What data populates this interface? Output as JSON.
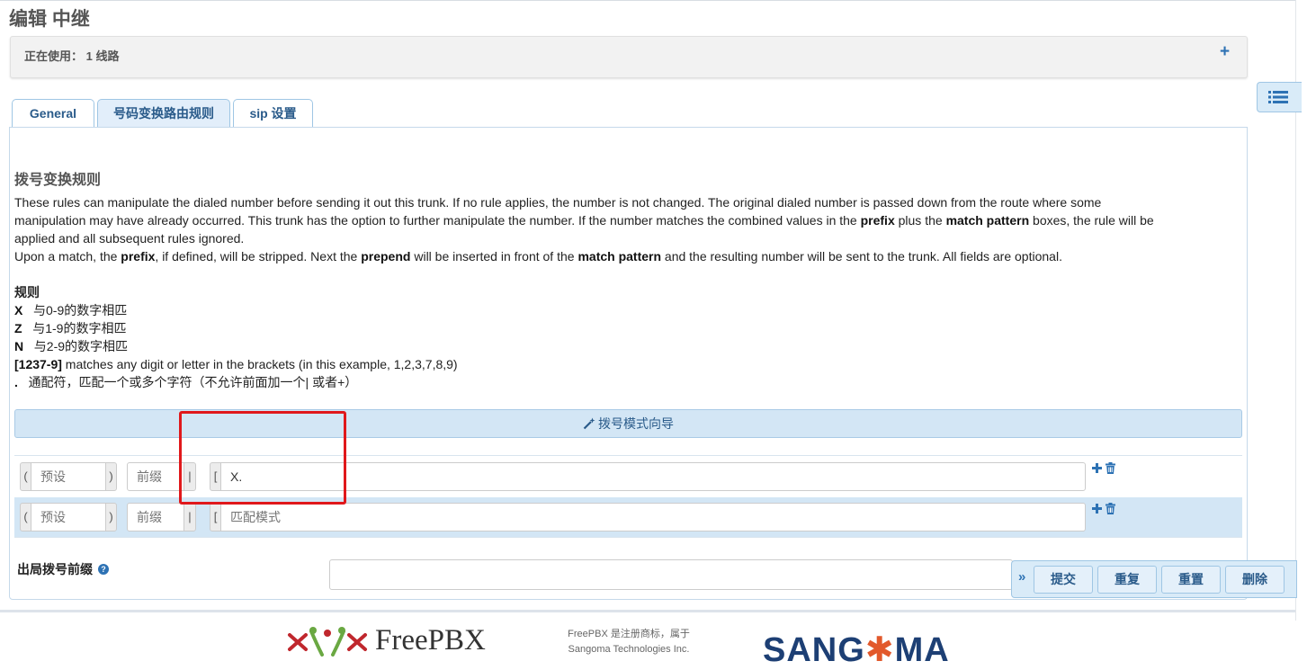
{
  "page": {
    "title": "编辑 中继"
  },
  "in_use": {
    "label": "正在使用： 1 线路",
    "add_symbol": "+"
  },
  "tabs": [
    {
      "label": "General"
    },
    {
      "label": "号码变换路由规则"
    },
    {
      "label": "sip 设置"
    }
  ],
  "dial_rules": {
    "title": "拨号变换规则",
    "desc1": {
      "a": "These rules can manipulate the dialed number before sending it out this trunk. If no rule applies, the number is not changed. The original dialed number is passed down from the route where some",
      "b": "manipulation may have already occurred. This trunk has the option to further manipulate the number. If the number matches the combined values in the ",
      "b_prefix": "prefix",
      "b_mid": " plus the ",
      "b_match": "match pattern",
      "b_end": " boxes, the rule will be",
      "c": "applied and all subsequent rules ignored."
    },
    "desc2": {
      "a": "Upon a match, the ",
      "prefix": "prefix",
      "b": ", if defined, will be stripped. Next the ",
      "prepend": "prepend",
      "c": " will be inserted in front of the ",
      "match": "match pattern",
      "d": " and the resulting number will be sent to the trunk. All fields are optional."
    },
    "rules_title": "规则",
    "rules": [
      {
        "key": "X",
        "text": "与0-9的数字相匹"
      },
      {
        "key": "Z",
        "text": "与1-9的数字相匹"
      },
      {
        "key": "N",
        "text": "与2-9的数字相匹"
      },
      {
        "key": "[1237-9]",
        "text": " matches any digit or letter in the brackets (in this example, 1,2,3,7,8,9)"
      },
      {
        "key": ".",
        "text": "通配符，匹配一个或多个字符（不允许前面加一个| 或者+）"
      }
    ],
    "wizard_label": "拨号模式向导"
  },
  "pattern_rows": [
    {
      "open_paren": "(",
      "prepend_placeholder": "预设",
      "close_paren": ")",
      "prefix_placeholder": "前缀",
      "pipe": "|",
      "bracket": "[",
      "match_value": "X.",
      "match_placeholder": "匹配模式"
    },
    {
      "open_paren": "(",
      "prepend_placeholder": "预设",
      "close_paren": ")",
      "prefix_placeholder": "前缀",
      "pipe": "|",
      "bracket": "[",
      "match_value": "",
      "match_placeholder": "匹配模式"
    }
  ],
  "outbound_prefix": {
    "label": "出局拨号前缀",
    "value": ""
  },
  "actions": {
    "expand": "»",
    "submit": "提交",
    "duplicate": "重复",
    "reset": "重置",
    "delete": "删除"
  },
  "footer": {
    "freepbx": "FreePBX",
    "legal_line1": "FreePBX 是注册商标，属于",
    "legal_line2": "Sangoma Technologies Inc.",
    "sangoma_left": "SANG",
    "sangoma_star": "✱",
    "sangoma_right": "MA"
  },
  "colors": {
    "accent": "#2d72b4",
    "highlight_box": "#e0181b",
    "row_highlight": "#d3e6f5"
  }
}
